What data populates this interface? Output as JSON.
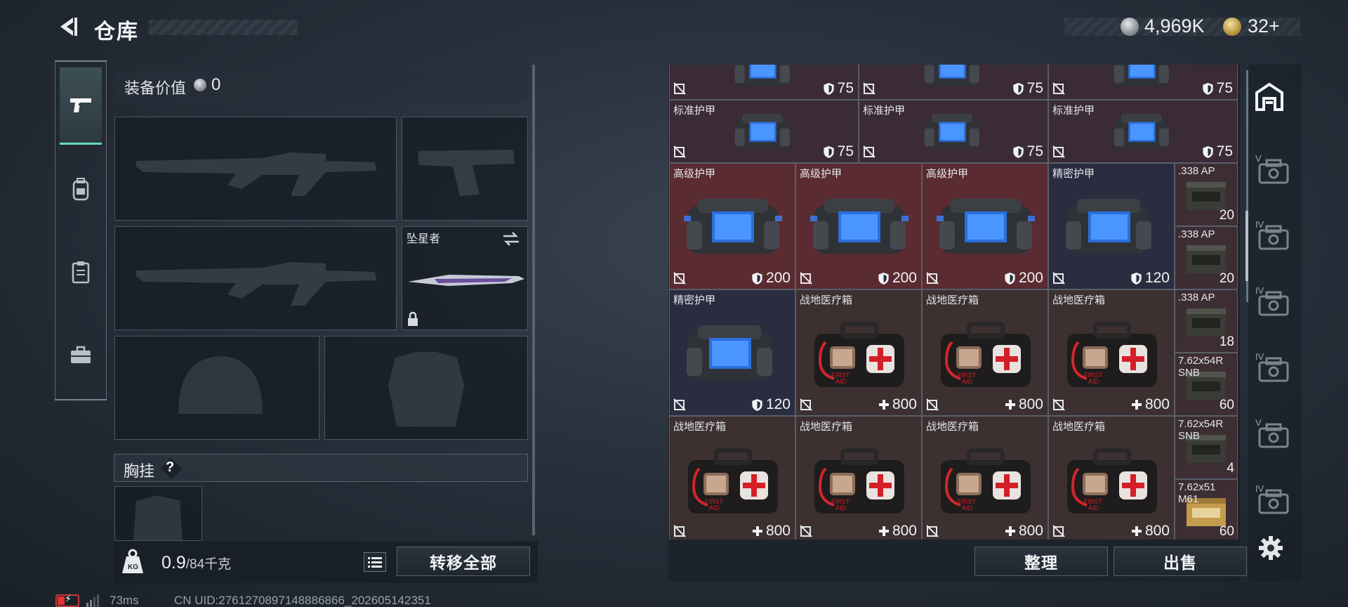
{
  "header": {
    "title": "仓库",
    "silver_amount": "4,969K",
    "gold_amount": "32+"
  },
  "loadout": {
    "value_label": "装备价值",
    "value": "0",
    "melee_name": "坠星者",
    "chest_rig_label": "胸挂",
    "chest_rig_help": "?",
    "weight_current": "0.9",
    "weight_max": "/84千克",
    "transfer_all_label": "转移全部"
  },
  "status": {
    "ping": "73ms",
    "uid": "CN UID:2761270897148886866_202605142351"
  },
  "warehouse": {
    "rows": [
      {
        "items": [
          {
            "name": "",
            "value": "75",
            "kind": "armor"
          },
          {
            "name": "",
            "value": "75",
            "kind": "armor"
          },
          {
            "name": "",
            "value": "75",
            "kind": "armor"
          }
        ]
      },
      {
        "items": [
          {
            "name": "标准护甲",
            "value": "75",
            "kind": "armor"
          },
          {
            "name": "标准护甲",
            "value": "75",
            "kind": "armor"
          },
          {
            "name": "标准护甲",
            "value": "75",
            "kind": "armor"
          }
        ]
      },
      {
        "items": [
          {
            "name": "高级护甲",
            "value": "200",
            "kind": "armor"
          },
          {
            "name": "高级护甲",
            "value": "200",
            "kind": "armor"
          },
          {
            "name": "高级护甲",
            "value": "200",
            "kind": "armor"
          },
          {
            "name": "精密护甲",
            "value": "120",
            "kind": "armor"
          }
        ]
      },
      {
        "items": [
          {
            "name": "精密护甲",
            "value": "120",
            "kind": "armor"
          },
          {
            "name": "战地医疗箱",
            "value": "800",
            "kind": "med"
          },
          {
            "name": "战地医疗箱",
            "value": "800",
            "kind": "med"
          },
          {
            "name": "战地医疗箱",
            "value": "800",
            "kind": "med"
          }
        ]
      },
      {
        "items": [
          {
            "name": "战地医疗箱",
            "value": "800",
            "kind": "med"
          },
          {
            "name": "战地医疗箱",
            "value": "800",
            "kind": "med"
          },
          {
            "name": "战地医疗箱",
            "value": "800",
            "kind": "med"
          },
          {
            "name": "战地医疗箱",
            "value": "800",
            "kind": "med"
          }
        ]
      }
    ],
    "ammo": [
      {
        "name": ".338 AP",
        "count": "20"
      },
      {
        "name": ".338 AP",
        "count": "20"
      },
      {
        "name": ".338 AP",
        "count": "18"
      },
      {
        "name": "7.62x54R SNB",
        "count": "60"
      },
      {
        "name": "7.62x54R SNB",
        "count": "4"
      },
      {
        "name": "7.62x51 M61",
        "count": "60"
      }
    ],
    "sort_label": "整理",
    "sell_label": "出售"
  },
  "right_tabs": [
    "V",
    "IV",
    "IV",
    "IV",
    "V",
    "IV"
  ],
  "colors": {
    "accent_teal": "#68d7c0",
    "high_grade_red": "#5a2b30",
    "battery_red": "#d33"
  },
  "icons": [
    "back-arrow-icon",
    "silver-coin-icon",
    "gold-coin-icon",
    "pistol-icon",
    "backpack-icon",
    "clipboard-icon",
    "toolbox-icon",
    "swap-icon",
    "lock-icon",
    "kg-weight-icon",
    "list-icon",
    "shield-icon",
    "no-insurance-icon",
    "plus-icon",
    "warehouse-home-icon",
    "case-icon",
    "gear-icon",
    "battery-icon",
    "signal-icon"
  ]
}
